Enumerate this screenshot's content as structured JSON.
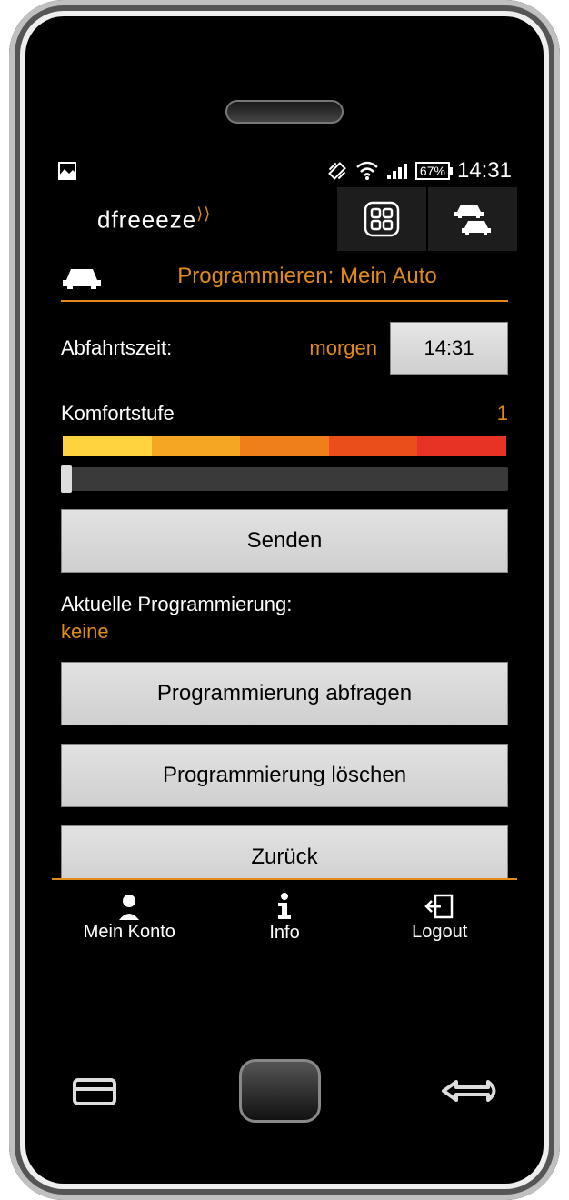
{
  "status": {
    "battery": "67%",
    "time": "14:31"
  },
  "brand": {
    "name": "dfreeeze"
  },
  "page": {
    "title": "Programmieren: Mein Auto"
  },
  "departure": {
    "label": "Abfahrtszeit:",
    "day": "morgen",
    "time": "14:31"
  },
  "comfort": {
    "label": "Komfortstufe",
    "level": "1"
  },
  "buttons": {
    "send": "Senden",
    "query": "Programmierung abfragen",
    "delete": "Programmierung löschen",
    "back": "Zurück"
  },
  "current": {
    "label": "Aktuelle Programmierung:",
    "value": "keine"
  },
  "footer": {
    "account": "Mein Konto",
    "info": "Info",
    "logout": "Logout"
  }
}
